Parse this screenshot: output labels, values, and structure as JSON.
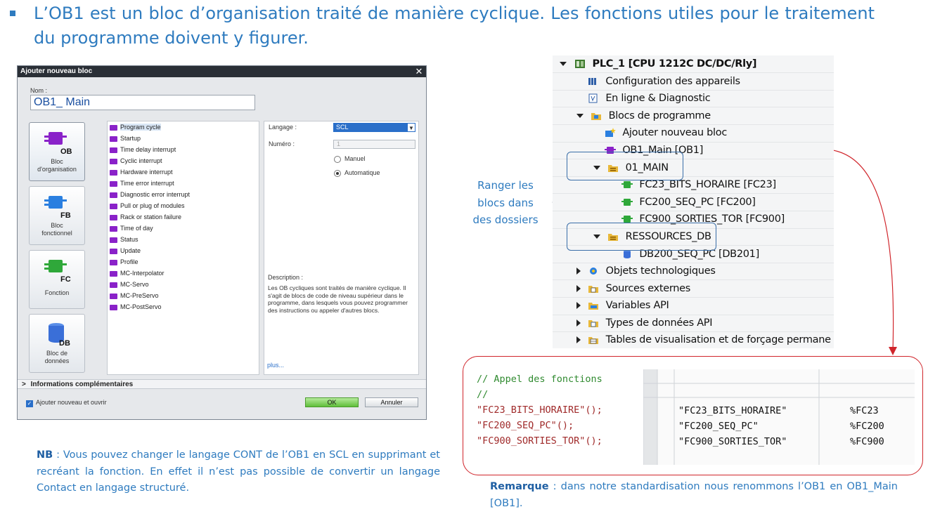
{
  "heading": {
    "text": "L’OB1 est un bloc d’organisation traité de manière cyclique. Les fonctions utiles pour le traitement du programme doivent y figurer."
  },
  "dialog": {
    "title": "Ajouter nouveau bloc",
    "close": "✕",
    "name_label": "Nom :",
    "name_value": "OB1_ Main",
    "block_types": [
      {
        "label_line1": "Bloc",
        "label_line2": "d'organisation",
        "icon_text": "OB"
      },
      {
        "label_line1": "Bloc",
        "label_line2": "fonctionnel",
        "icon_text": "FB"
      },
      {
        "label_line1": "Fonction",
        "label_line2": "",
        "icon_text": "FC"
      },
      {
        "label_line1": "Bloc de",
        "label_line2": "données",
        "icon_text": "DB"
      }
    ],
    "ob_list": [
      "Program cycle",
      "Startup",
      "Time delay interrupt",
      "Cyclic interrupt",
      "Hardware interrupt",
      "Time error interrupt",
      "Diagnostic error interrupt",
      "Pull or plug of modules",
      "Rack or station failure",
      "Time of day",
      "Status",
      "Update",
      "Profile",
      "MC-Interpolator",
      "MC-Servo",
      "MC-PreServo",
      "MC-PostServo"
    ],
    "language_label": "Langage :",
    "language_value": "SCL",
    "number_label": "Numéro :",
    "number_value": "1",
    "radio_manual": "Manuel",
    "radio_auto": "Automatique",
    "description_label": "Description :",
    "description_text": "Les OB cycliques sont traités de manière cyclique. Il s'agit de blocs de code de niveau supérieur dans le programme, dans lesquels vous pouvez programmer des instructions ou appeler d'autres blocs.",
    "more_link": "plus...",
    "info_bar": "Informations complémentaires",
    "info_arrow": ">",
    "checkbox_label": "Ajouter nouveau et ouvrir",
    "ok": "OK",
    "cancel": "Annuler"
  },
  "nb_note": {
    "label": "NB",
    "text": " : Vous pouvez changer le langage CONT de l’OB1 en SCL en supprimant et recréant la fonction. En effet il n’est pas possible de convertir un langage Contact en langage structuré."
  },
  "tree": {
    "plc": "PLC_1 [CPU 1212C DC/DC/Rly]",
    "config": "Configuration des appareils",
    "online": "En ligne & Diagnostic",
    "blocks": "Blocs de programme",
    "add_block": "Ajouter nouveau bloc",
    "ob1": "OB1_Main [OB1]",
    "folder_main": "01_MAIN",
    "fc23": "FC23_BITS_HORAIRE [FC23]",
    "fc200": "FC200_SEQ_PC [FC200]",
    "fc900": "FC900_SORTIES_TOR [FC900]",
    "folder_res": "RESSOURCES_DB",
    "db200": "DB200_SEQ_PC [DB201]",
    "tech": "Objets technologiques",
    "sources": "Sources externes",
    "vars": "Variables API",
    "types": "Types de données API",
    "tables": "Tables de visualisation et de forçage permane"
  },
  "ranger_note": {
    "line1": "Ranger les",
    "line2": "blocs dans",
    "line3": "des dossiers"
  },
  "code": {
    "comment1": "// Appel des fonctions",
    "comment2": "//",
    "call1": "\"FC23_BITS_HORAIRE\"();",
    "call2": "\"FC200_SEQ_PC\"();",
    "call3": "\"FC900_SORTIES_TOR\"();",
    "table": [
      {
        "name": "\"FC23_BITS_HORAIRE\"",
        "addr": "%FC23"
      },
      {
        "name": "\"FC200_SEQ_PC\"",
        "addr": "%FC200"
      },
      {
        "name": "\"FC900_SORTIES_TOR\"",
        "addr": "%FC900"
      }
    ]
  },
  "remark": {
    "label": "Remarque",
    "text": " : dans notre standardisation nous renommons l’OB1 en OB1_Main [OB1]."
  },
  "colors": {
    "text_blue": "#2e7bbf",
    "ob_purple": "#8a22c9",
    "fc_green": "#2fa83a",
    "db_blue": "#3a6fd8",
    "highlight_red": "#d0252b"
  }
}
